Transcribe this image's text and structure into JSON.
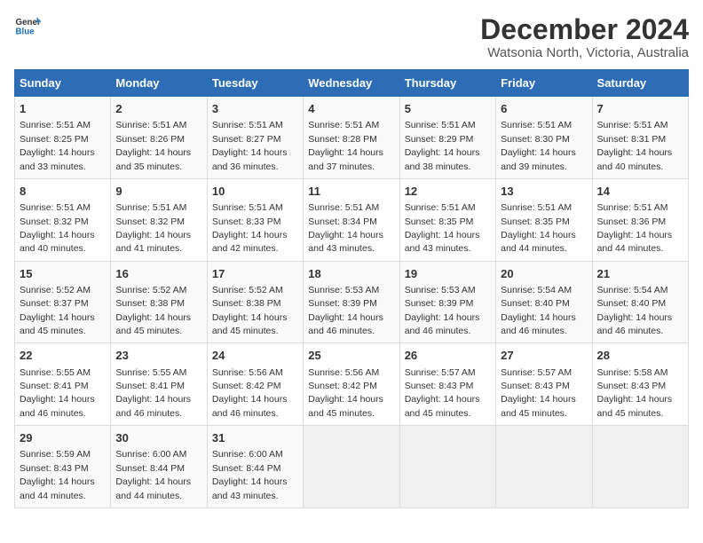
{
  "logo": {
    "line1": "General",
    "line2": "Blue"
  },
  "title": "December 2024",
  "subtitle": "Watsonia North, Victoria, Australia",
  "days_of_week": [
    "Sunday",
    "Monday",
    "Tuesday",
    "Wednesday",
    "Thursday",
    "Friday",
    "Saturday"
  ],
  "weeks": [
    [
      {
        "day": "1",
        "sunrise": "Sunrise: 5:51 AM",
        "sunset": "Sunset: 8:25 PM",
        "daylight": "Daylight: 14 hours and 33 minutes."
      },
      {
        "day": "2",
        "sunrise": "Sunrise: 5:51 AM",
        "sunset": "Sunset: 8:26 PM",
        "daylight": "Daylight: 14 hours and 35 minutes."
      },
      {
        "day": "3",
        "sunrise": "Sunrise: 5:51 AM",
        "sunset": "Sunset: 8:27 PM",
        "daylight": "Daylight: 14 hours and 36 minutes."
      },
      {
        "day": "4",
        "sunrise": "Sunrise: 5:51 AM",
        "sunset": "Sunset: 8:28 PM",
        "daylight": "Daylight: 14 hours and 37 minutes."
      },
      {
        "day": "5",
        "sunrise": "Sunrise: 5:51 AM",
        "sunset": "Sunset: 8:29 PM",
        "daylight": "Daylight: 14 hours and 38 minutes."
      },
      {
        "day": "6",
        "sunrise": "Sunrise: 5:51 AM",
        "sunset": "Sunset: 8:30 PM",
        "daylight": "Daylight: 14 hours and 39 minutes."
      },
      {
        "day": "7",
        "sunrise": "Sunrise: 5:51 AM",
        "sunset": "Sunset: 8:31 PM",
        "daylight": "Daylight: 14 hours and 40 minutes."
      }
    ],
    [
      {
        "day": "8",
        "sunrise": "Sunrise: 5:51 AM",
        "sunset": "Sunset: 8:32 PM",
        "daylight": "Daylight: 14 hours and 40 minutes."
      },
      {
        "day": "9",
        "sunrise": "Sunrise: 5:51 AM",
        "sunset": "Sunset: 8:32 PM",
        "daylight": "Daylight: 14 hours and 41 minutes."
      },
      {
        "day": "10",
        "sunrise": "Sunrise: 5:51 AM",
        "sunset": "Sunset: 8:33 PM",
        "daylight": "Daylight: 14 hours and 42 minutes."
      },
      {
        "day": "11",
        "sunrise": "Sunrise: 5:51 AM",
        "sunset": "Sunset: 8:34 PM",
        "daylight": "Daylight: 14 hours and 43 minutes."
      },
      {
        "day": "12",
        "sunrise": "Sunrise: 5:51 AM",
        "sunset": "Sunset: 8:35 PM",
        "daylight": "Daylight: 14 hours and 43 minutes."
      },
      {
        "day": "13",
        "sunrise": "Sunrise: 5:51 AM",
        "sunset": "Sunset: 8:35 PM",
        "daylight": "Daylight: 14 hours and 44 minutes."
      },
      {
        "day": "14",
        "sunrise": "Sunrise: 5:51 AM",
        "sunset": "Sunset: 8:36 PM",
        "daylight": "Daylight: 14 hours and 44 minutes."
      }
    ],
    [
      {
        "day": "15",
        "sunrise": "Sunrise: 5:52 AM",
        "sunset": "Sunset: 8:37 PM",
        "daylight": "Daylight: 14 hours and 45 minutes."
      },
      {
        "day": "16",
        "sunrise": "Sunrise: 5:52 AM",
        "sunset": "Sunset: 8:38 PM",
        "daylight": "Daylight: 14 hours and 45 minutes."
      },
      {
        "day": "17",
        "sunrise": "Sunrise: 5:52 AM",
        "sunset": "Sunset: 8:38 PM",
        "daylight": "Daylight: 14 hours and 45 minutes."
      },
      {
        "day": "18",
        "sunrise": "Sunrise: 5:53 AM",
        "sunset": "Sunset: 8:39 PM",
        "daylight": "Daylight: 14 hours and 46 minutes."
      },
      {
        "day": "19",
        "sunrise": "Sunrise: 5:53 AM",
        "sunset": "Sunset: 8:39 PM",
        "daylight": "Daylight: 14 hours and 46 minutes."
      },
      {
        "day": "20",
        "sunrise": "Sunrise: 5:54 AM",
        "sunset": "Sunset: 8:40 PM",
        "daylight": "Daylight: 14 hours and 46 minutes."
      },
      {
        "day": "21",
        "sunrise": "Sunrise: 5:54 AM",
        "sunset": "Sunset: 8:40 PM",
        "daylight": "Daylight: 14 hours and 46 minutes."
      }
    ],
    [
      {
        "day": "22",
        "sunrise": "Sunrise: 5:55 AM",
        "sunset": "Sunset: 8:41 PM",
        "daylight": "Daylight: 14 hours and 46 minutes."
      },
      {
        "day": "23",
        "sunrise": "Sunrise: 5:55 AM",
        "sunset": "Sunset: 8:41 PM",
        "daylight": "Daylight: 14 hours and 46 minutes."
      },
      {
        "day": "24",
        "sunrise": "Sunrise: 5:56 AM",
        "sunset": "Sunset: 8:42 PM",
        "daylight": "Daylight: 14 hours and 46 minutes."
      },
      {
        "day": "25",
        "sunrise": "Sunrise: 5:56 AM",
        "sunset": "Sunset: 8:42 PM",
        "daylight": "Daylight: 14 hours and 45 minutes."
      },
      {
        "day": "26",
        "sunrise": "Sunrise: 5:57 AM",
        "sunset": "Sunset: 8:43 PM",
        "daylight": "Daylight: 14 hours and 45 minutes."
      },
      {
        "day": "27",
        "sunrise": "Sunrise: 5:57 AM",
        "sunset": "Sunset: 8:43 PM",
        "daylight": "Daylight: 14 hours and 45 minutes."
      },
      {
        "day": "28",
        "sunrise": "Sunrise: 5:58 AM",
        "sunset": "Sunset: 8:43 PM",
        "daylight": "Daylight: 14 hours and 45 minutes."
      }
    ],
    [
      {
        "day": "29",
        "sunrise": "Sunrise: 5:59 AM",
        "sunset": "Sunset: 8:43 PM",
        "daylight": "Daylight: 14 hours and 44 minutes."
      },
      {
        "day": "30",
        "sunrise": "Sunrise: 6:00 AM",
        "sunset": "Sunset: 8:44 PM",
        "daylight": "Daylight: 14 hours and 44 minutes."
      },
      {
        "day": "31",
        "sunrise": "Sunrise: 6:00 AM",
        "sunset": "Sunset: 8:44 PM",
        "daylight": "Daylight: 14 hours and 43 minutes."
      },
      null,
      null,
      null,
      null
    ]
  ]
}
